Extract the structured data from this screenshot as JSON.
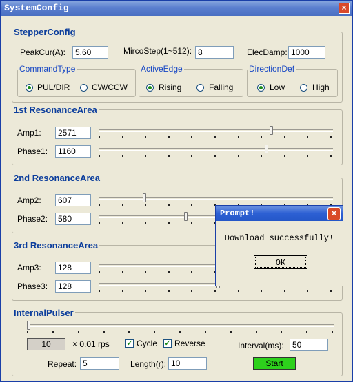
{
  "window": {
    "title": "SystemConfig",
    "close": "×"
  },
  "stepper": {
    "legend": "StepperConfig",
    "peak_label": "PeakCur(A):",
    "peak_value": "5.60",
    "micro_label": "MircoStep(1~512):",
    "micro_value": "8",
    "damp_label": "ElecDamp:",
    "damp_value": "1000",
    "command": {
      "legend": "CommandType",
      "opt1": "PUL/DIR",
      "opt2": "CW/CCW",
      "selected": "PUL/DIR"
    },
    "edge": {
      "legend": "ActiveEdge",
      "opt1": "Rising",
      "opt2": "Falling",
      "selected": "Rising"
    },
    "direction": {
      "legend": "DirectionDef",
      "opt1": "Low",
      "opt2": "High",
      "selected": "Low"
    }
  },
  "res1": {
    "legend": "1st ResonanceArea",
    "amp_label": "Amp1:",
    "amp_value": "2571",
    "phase_label": "Phase1:",
    "phase_value": "1160"
  },
  "res2": {
    "legend": "2nd ResonanceArea",
    "amp_label": "Amp2:",
    "amp_value": "607",
    "phase_label": "Phase2:",
    "phase_value": "580"
  },
  "res3": {
    "legend": "3rd ResonanceArea",
    "amp_label": "Amp3:",
    "amp_value": "128",
    "phase_label": "Phase3:",
    "phase_value": "128"
  },
  "pulser": {
    "legend": "InternalPulser",
    "speed_value": "10",
    "speed_unit": "× 0.01 rps",
    "cycle_label": "Cycle",
    "cycle_checked": true,
    "reverse_label": "Reverse",
    "reverse_checked": true,
    "interval_label": "Interval(ms):",
    "interval_value": "50",
    "repeat_label": "Repeat:",
    "repeat_value": "5",
    "length_label": "Length(r):",
    "length_value": "10",
    "start_label": "Start"
  },
  "dialog": {
    "title": "Prompt!",
    "close": "×",
    "message": "Download successfully!",
    "ok_label": "OK"
  },
  "colors": {
    "legend": "#0b3d9c",
    "start_button": "#2dd11c",
    "titlebar": "#4a6fc2",
    "dialog_titlebar": "#2457c8"
  }
}
